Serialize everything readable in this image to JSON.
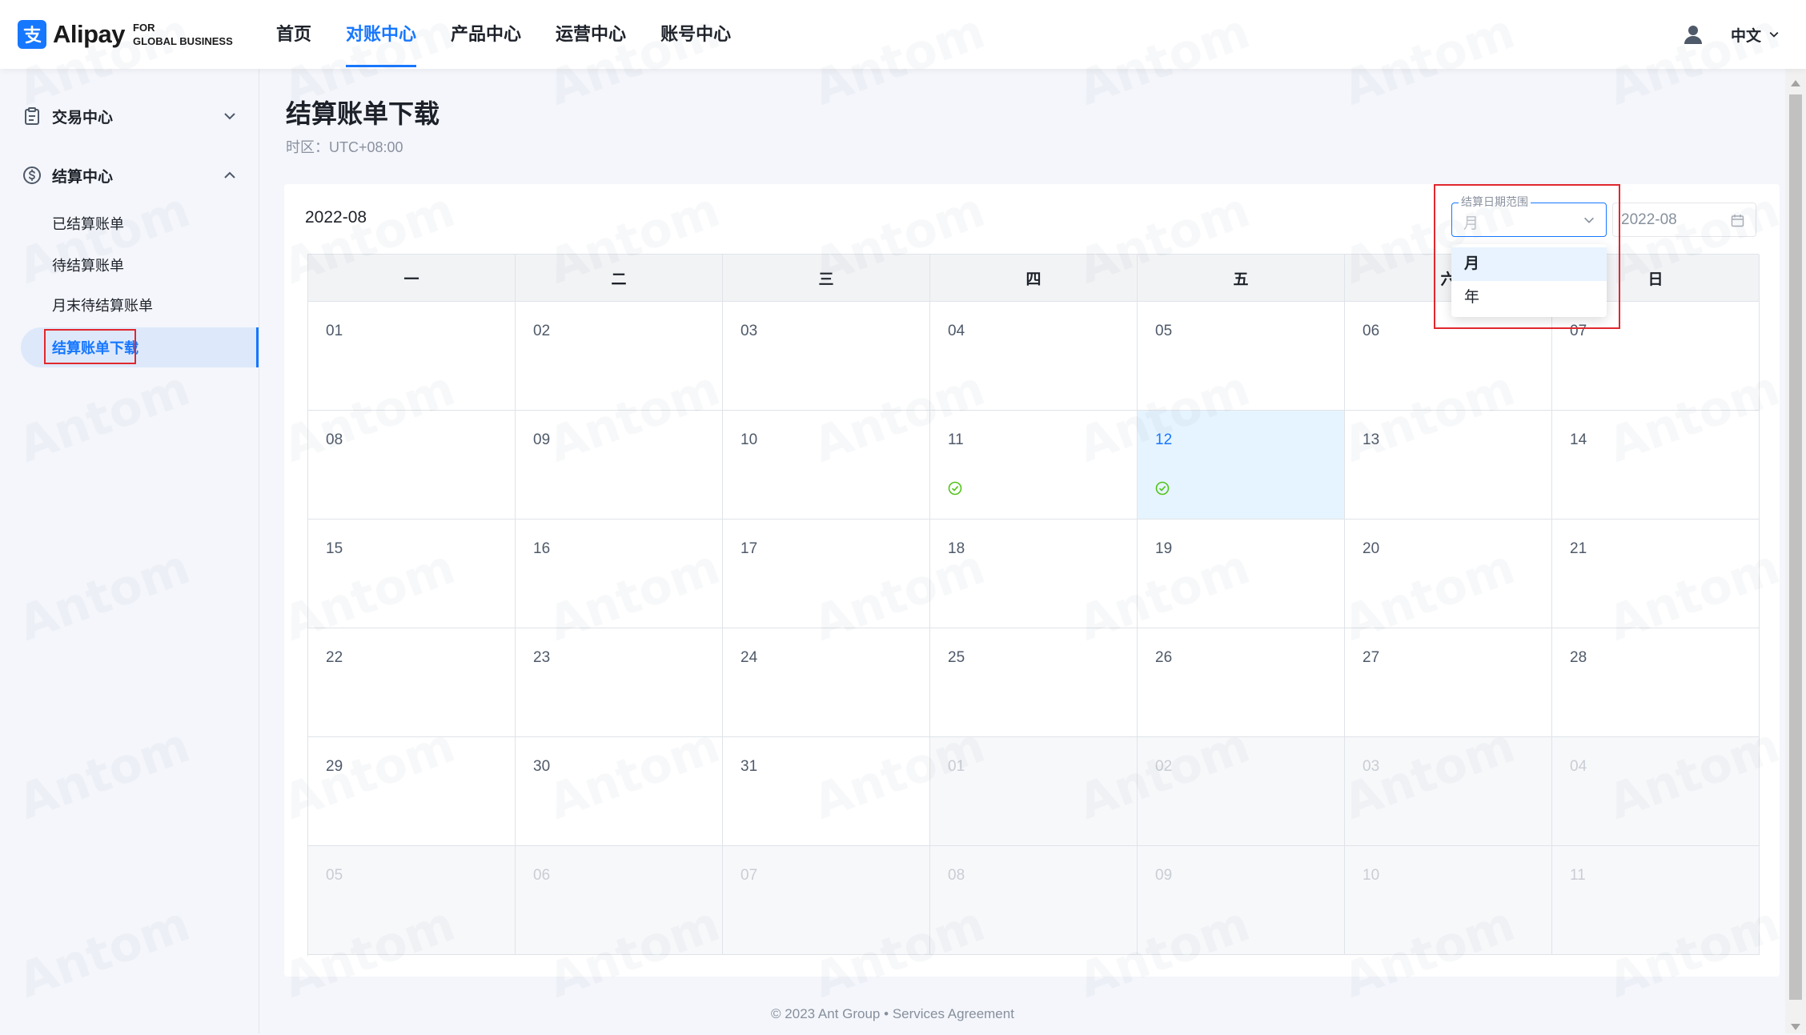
{
  "header": {
    "logo_brand": "Alipay",
    "logo_sub_line1": "FOR",
    "logo_sub_line2": "GLOBAL BUSINESS",
    "nav": [
      {
        "label": "首页",
        "active": false
      },
      {
        "label": "对账中心",
        "active": true
      },
      {
        "label": "产品中心",
        "active": false
      },
      {
        "label": "运营中心",
        "active": false
      },
      {
        "label": "账号中心",
        "active": false
      }
    ],
    "language": "中文"
  },
  "sidebar": {
    "groups": [
      {
        "label": "交易中心",
        "icon": "clipboard-icon",
        "expanded": false
      },
      {
        "label": "结算中心",
        "icon": "dollar-circle-icon",
        "expanded": true,
        "items": [
          {
            "label": "已结算账单",
            "active": false
          },
          {
            "label": "待结算账单",
            "active": false
          },
          {
            "label": "月末待结算账单",
            "active": false
          },
          {
            "label": "结算账单下载",
            "active": true
          }
        ]
      }
    ]
  },
  "main": {
    "title": "结算账单下载",
    "timezone": "时区：UTC+08:00"
  },
  "filter": {
    "select_label": "结算日期范围",
    "select_value": "月",
    "options": [
      {
        "label": "月",
        "selected": true
      },
      {
        "label": "年",
        "selected": false
      }
    ],
    "date_value": "2022-08"
  },
  "calendar": {
    "month_label": "2022-08",
    "weekdays": [
      "一",
      "二",
      "三",
      "四",
      "五",
      "六",
      "日"
    ],
    "weeks": [
      [
        {
          "day": "01"
        },
        {
          "day": "02"
        },
        {
          "day": "03"
        },
        {
          "day": "04"
        },
        {
          "day": "05"
        },
        {
          "day": "06"
        },
        {
          "day": "07"
        }
      ],
      [
        {
          "day": "08"
        },
        {
          "day": "09"
        },
        {
          "day": "10"
        },
        {
          "day": "11",
          "settled": true
        },
        {
          "day": "12",
          "settled": true,
          "selected": true
        },
        {
          "day": "13"
        },
        {
          "day": "14"
        }
      ],
      [
        {
          "day": "15"
        },
        {
          "day": "16"
        },
        {
          "day": "17"
        },
        {
          "day": "18"
        },
        {
          "day": "19"
        },
        {
          "day": "20"
        },
        {
          "day": "21"
        }
      ],
      [
        {
          "day": "22"
        },
        {
          "day": "23"
        },
        {
          "day": "24"
        },
        {
          "day": "25"
        },
        {
          "day": "26"
        },
        {
          "day": "27"
        },
        {
          "day": "28"
        }
      ],
      [
        {
          "day": "29"
        },
        {
          "day": "30"
        },
        {
          "day": "31"
        },
        {
          "day": "01",
          "other_month": true
        },
        {
          "day": "02",
          "other_month": true
        },
        {
          "day": "03",
          "other_month": true
        },
        {
          "day": "04",
          "other_month": true
        }
      ],
      [
        {
          "day": "05",
          "other_month": true
        },
        {
          "day": "06",
          "other_month": true
        },
        {
          "day": "07",
          "other_month": true
        },
        {
          "day": "08",
          "other_month": true
        },
        {
          "day": "09",
          "other_month": true
        },
        {
          "day": "10",
          "other_month": true
        },
        {
          "day": "11",
          "other_month": true
        }
      ]
    ]
  },
  "footer": {
    "copyright": "© 2023 Ant Group",
    "separator": "•",
    "link": "Services Agreement"
  },
  "watermark": "Antom",
  "colors": {
    "accent": "#1677ff",
    "settled": "#52c41a",
    "highlight_box": "#e0282e",
    "page_background": "#f4f6fb"
  }
}
